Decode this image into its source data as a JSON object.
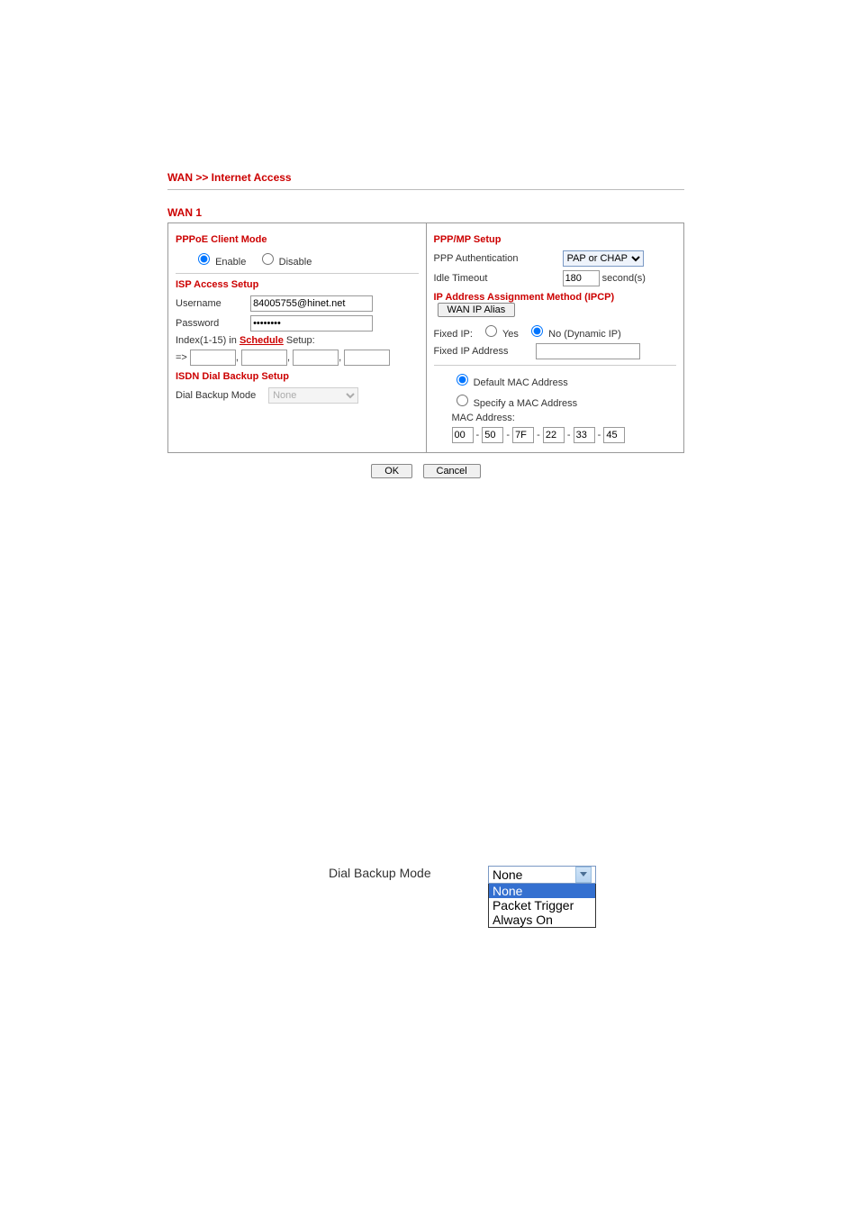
{
  "breadcrumb": "WAN >> Internet Access",
  "wan_title": "WAN 1",
  "left": {
    "pppoe_title": "PPPoE Client Mode",
    "enable_label": "Enable",
    "disable_label": "Disable",
    "isp_title": "ISP Access Setup",
    "username_label": "Username",
    "username_value": "84005755@hinet.net",
    "password_label": "Password",
    "password_value": "••••••••",
    "index_prefix": "Index(1-15) in ",
    "schedule_link": "Schedule",
    "index_suffix": " Setup:",
    "arrow": "=>",
    "isdn_title": "ISDN Dial Backup Setup",
    "dial_backup_label": "Dial Backup Mode",
    "dial_backup_value": "None"
  },
  "right": {
    "pppmp_title": "PPP/MP Setup",
    "ppp_auth_label": "PPP Authentication",
    "ppp_auth_value": "PAP or CHAP",
    "idle_label": "Idle Timeout",
    "idle_value": "180",
    "idle_unit": "second(s)",
    "ipcp_title": "IP Address Assignment Method (IPCP)",
    "wan_ip_alias_btn": "WAN IP Alias",
    "fixed_ip_label": "Fixed IP:",
    "fixed_ip_yes": "Yes",
    "fixed_ip_no": "No (Dynamic IP)",
    "fixed_ip_addr_label": "Fixed IP Address",
    "default_mac": "Default MAC Address",
    "specify_mac": "Specify a MAC Address",
    "mac_addr_label": "MAC Address:",
    "mac": [
      "00",
      "50",
      "7F",
      "22",
      "33",
      "45"
    ]
  },
  "buttons": {
    "ok": "OK",
    "cancel": "Cancel"
  },
  "dropdown_demo": {
    "label": "Dial Backup Mode",
    "selected": "None",
    "options": [
      "None",
      "Packet Trigger",
      "Always On"
    ]
  }
}
